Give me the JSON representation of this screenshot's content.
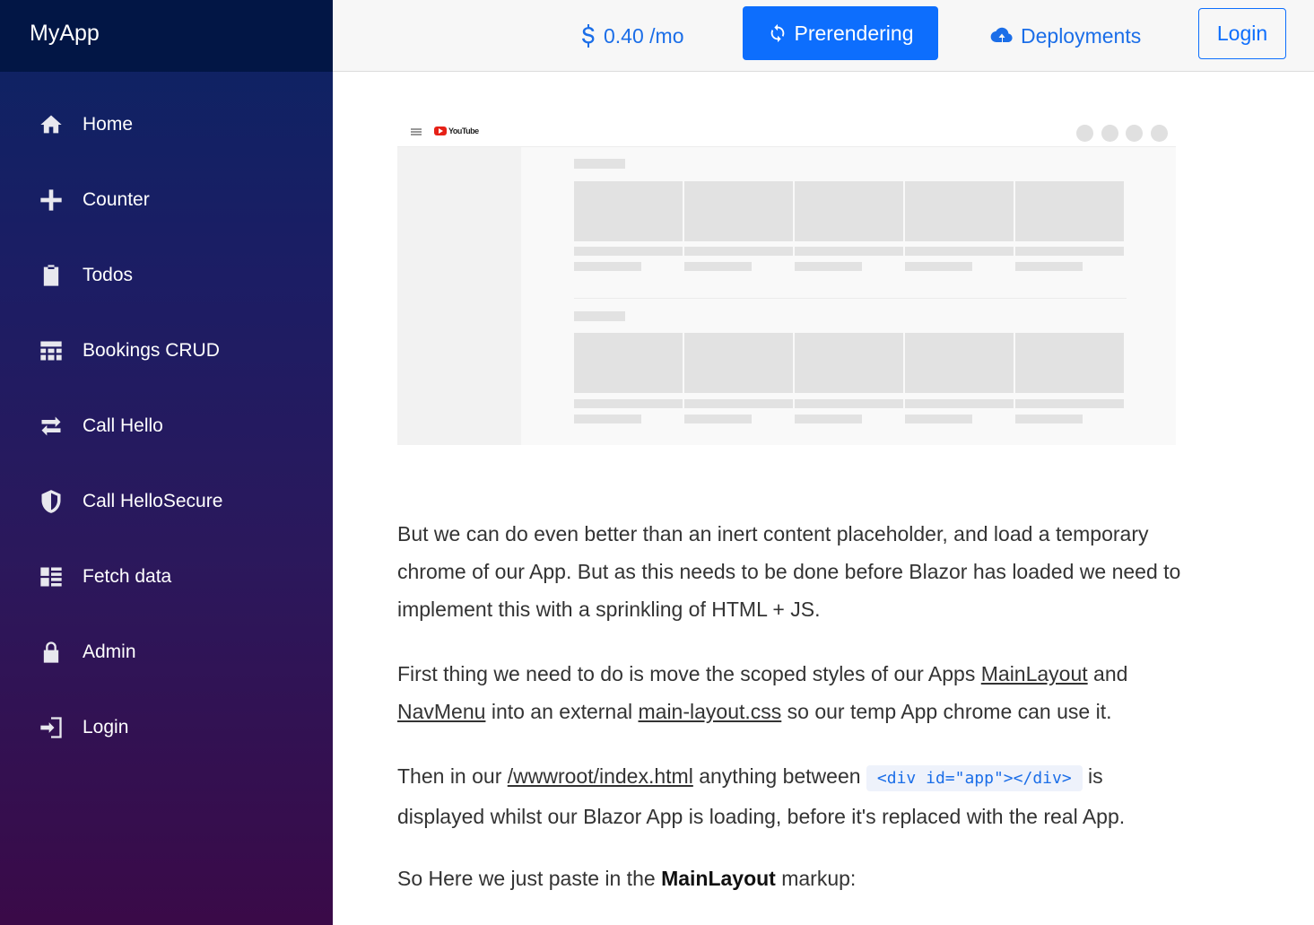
{
  "app": {
    "title": "MyApp"
  },
  "sidebar": {
    "items": [
      {
        "label": "Home",
        "icon": "home-icon"
      },
      {
        "label": "Counter",
        "icon": "plus-icon"
      },
      {
        "label": "Todos",
        "icon": "clipboard-icon"
      },
      {
        "label": "Bookings CRUD",
        "icon": "calendar-icon"
      },
      {
        "label": "Call Hello",
        "icon": "swap-icon"
      },
      {
        "label": "Call HelloSecure",
        "icon": "shield-icon"
      },
      {
        "label": "Fetch data",
        "icon": "list-icon"
      },
      {
        "label": "Admin",
        "icon": "lock-icon"
      },
      {
        "label": "Login",
        "icon": "login-icon"
      }
    ]
  },
  "topbar": {
    "price": "0.40 /mo",
    "prerendering": "Prerendering",
    "deployments": "Deployments",
    "login": "Login"
  },
  "mockup": {
    "logo_text": "YouTube"
  },
  "content": {
    "p1": "But we can do even better than an inert content placeholder, and load a temporary chrome of our App. But as this needs to be done before Blazor has loaded we need to implement this with a sprinkling of HTML + JS.",
    "p2_a": "First thing we need to do is move the scoped styles of our Apps ",
    "p2_link1": "MainLayout",
    "p2_b": " and ",
    "p2_link2": "NavMenu",
    "p2_c": " into an external ",
    "p2_link3": "main-layout.css",
    "p2_d": " so our temp App chrome can use it.",
    "p3_a": "Then in our ",
    "p3_link": "/wwwroot/index.html",
    "p3_b": " anything between ",
    "p3_code": "<div id=\"app\"></div>",
    "p3_c": " is displayed whilst our Blazor App is loading, before it's replaced with the real App.",
    "p4_a": "So Here we just paste in the ",
    "p4_strong": "MainLayout",
    "p4_b": " markup:"
  },
  "colors": {
    "brand_bg": "#021645",
    "accent": "#0d6efd",
    "link": "#1b6ee8"
  }
}
